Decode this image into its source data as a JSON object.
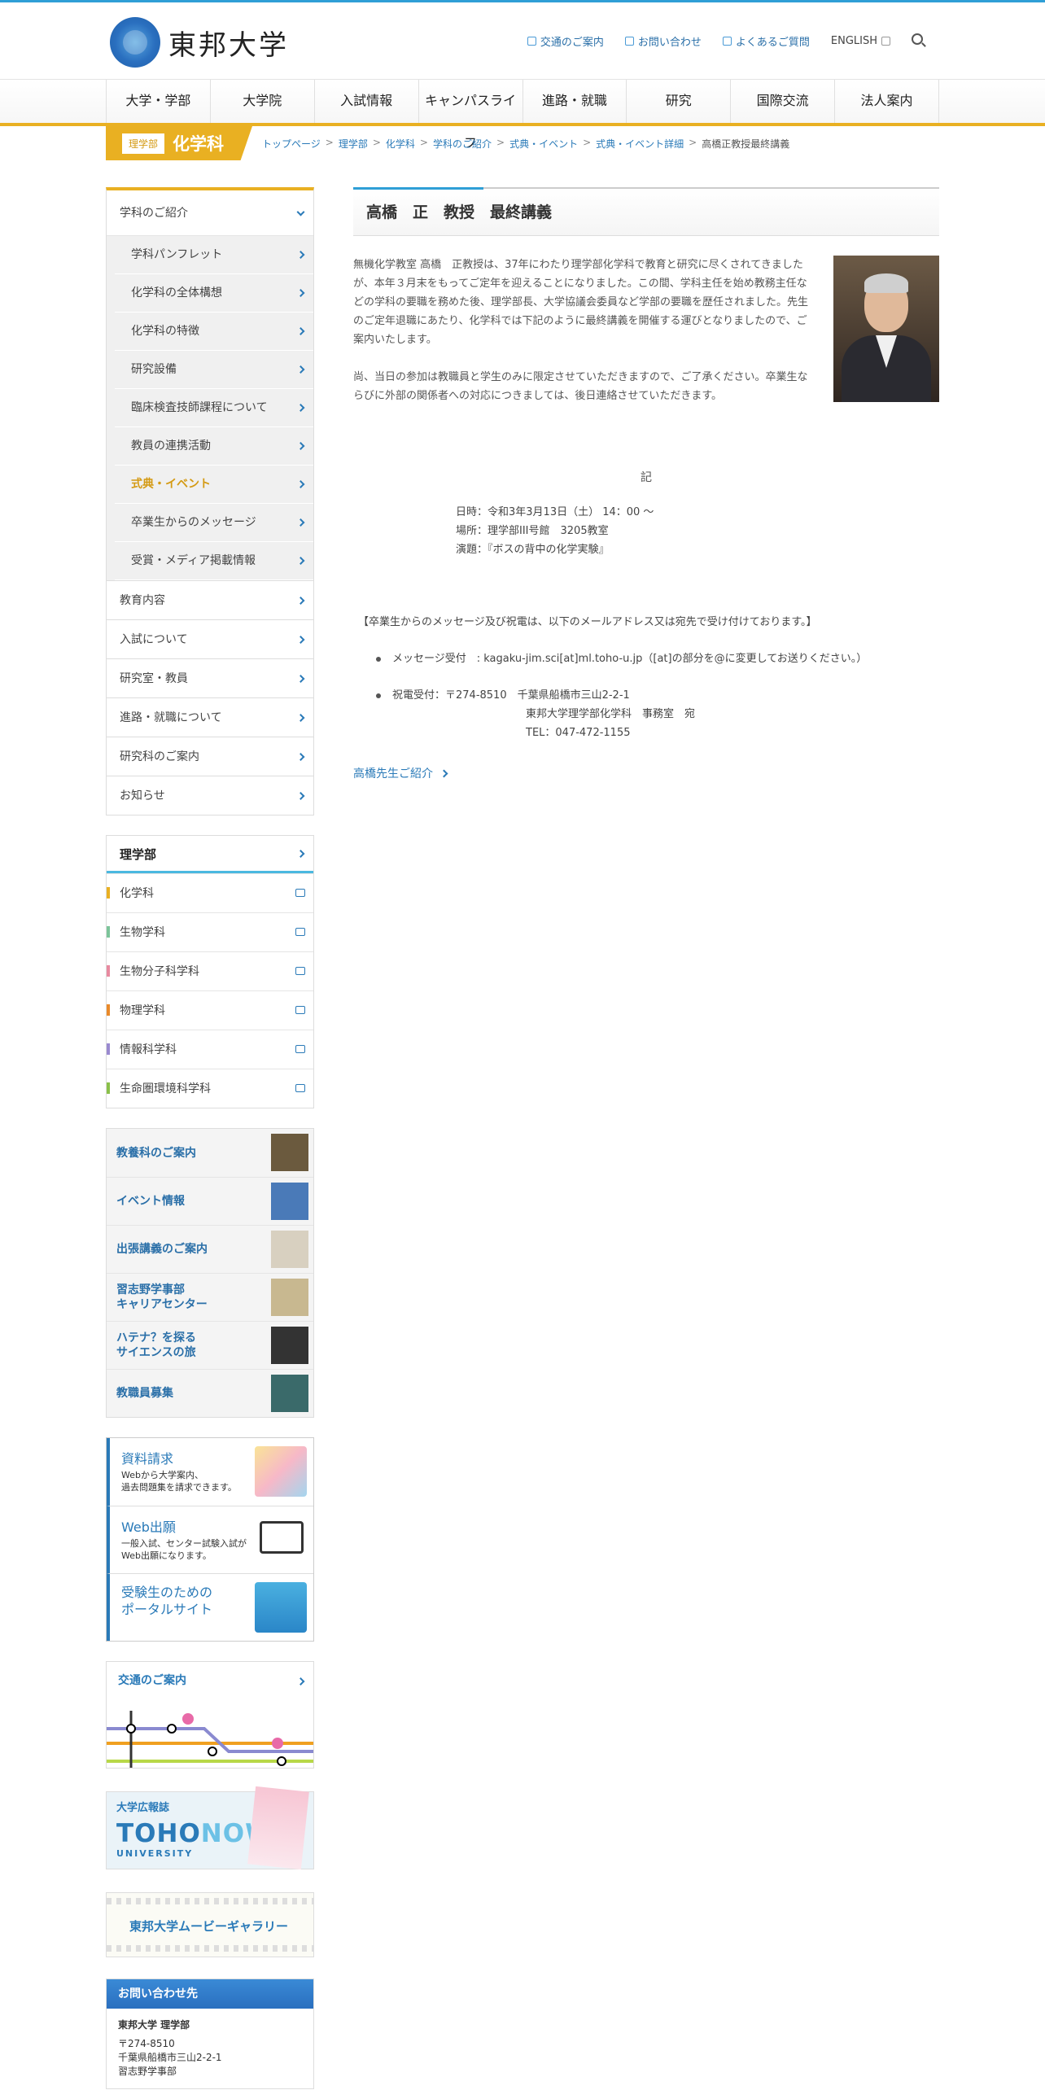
{
  "header": {
    "logo_text": "東邦大学",
    "util_links": [
      "交通のご案内",
      "お問い合わせ",
      "よくあるご質問"
    ],
    "english_label": "ENGLISH"
  },
  "gnav": [
    "大学・学部",
    "大学院",
    "入試情報",
    "キャンパスライフ",
    "進路・就職",
    "研究",
    "国際交流",
    "法人案内"
  ],
  "dept": {
    "tag": "理学部",
    "name": "化学科"
  },
  "breadcrumb": [
    "トップページ",
    "理学部",
    "化学科",
    "学科のご紹介",
    "式典・イベント",
    "式典・イベント詳細",
    "高橋正教授最終講義"
  ],
  "sidebar": {
    "menu_head": "学科のご紹介",
    "sub_items": [
      "学科パンフレット",
      "化学科の全体構想",
      "化学科の特徴",
      "研究設備",
      "臨床検査技師課程について",
      "教員の連携活動",
      "式典・イベント",
      "卒業生からのメッセージ",
      "受賞・メディア掲載情報"
    ],
    "active_index": 6,
    "menu_items": [
      "教育内容",
      "入試について",
      "研究室・教員",
      "進路・就職について",
      "研究科のご案内",
      "お知らせ"
    ],
    "rigaku_head": "理学部",
    "rigaku_items": [
      "化学科",
      "生物学科",
      "生物分子科学科",
      "物理学科",
      "情報科学科",
      "生命圏環境科学科"
    ],
    "rigaku_colors": [
      "#e9b022",
      "#7cc49a",
      "#e88aa0",
      "#e98a2a",
      "#9a8ad0",
      "#8ac04a"
    ],
    "links": [
      "教養科のご案内",
      "イベント情報",
      "出張講義のご案内",
      "習志野学事部\nキャリアセンター",
      "ハテナ？を探る\nサイエンスの旅",
      "教職員募集"
    ],
    "banners": [
      {
        "title": "資料請求",
        "sub": "Webから大学案内、\n過去問題集を請求できます。"
      },
      {
        "title": "Web出願",
        "sub": "一般入試、センター試験入試が\nWeb出願になります。"
      },
      {
        "title": "受験生のための\nポータルサイト",
        "sub": ""
      }
    ],
    "access_title": "交通のご案内",
    "magazine": {
      "small": "大学広報誌",
      "big_a": "TOHO",
      "big_b": "NOW",
      "uni": "UNIVERSITY"
    },
    "movie_text": "東邦大学ムービーギャラリー",
    "contact": {
      "head": "お問い合わせ先",
      "name": "東邦大学 理学部",
      "zip": "〒274-8510",
      "addr": "千葉県船橋市三山2-2-1",
      "dept": "習志野学事部"
    }
  },
  "main": {
    "title": "高橋　正　教授　最終講義",
    "intro_p1": "無機化学教室 高橋　正教授は、37年にわたり理学部化学科で教育と研究に尽くされてきましたが、本年３月末をもってご定年を迎えることになりました。この間、学科主任を始め教務主任などの学科の要職を務めた後、理学部長、大学協議会委員など学部の要職を歴任されました。先生のご定年退職にあたり、化学科では下記のように最終講義を開催する運びとなりましたので、ご案内いたします。",
    "intro_p2": "尚、当日の参加は教職員と学生のみに限定させていただきますので、ご了承ください。卒業生ならびに外部の関係者への対応につきましては、後日連絡させていただきます。",
    "ki": "記",
    "date": "日時：令和3年3月13日（土） 14：00 ～",
    "place": "場所：理学部III号館　3205教室",
    "topic": "演題：『ボスの背中の化学実験』",
    "msg": "【卒業生からのメッセージ及び祝電は、以下のメールアドレス又は宛先で受け付けております。】",
    "msg_line": "メッセージ受付　: kagaku-jim.sci[at]ml.toho-u.jp（[at]の部分を@に変更してお送りください。）",
    "tel_line1": "祝電受付：〒274-8510　千葉県船橋市三山2-2-1",
    "tel_line2": "東邦大学理学部化学科　事務室　宛",
    "tel_line3": "TEL：047-472-1155",
    "prof_link": "高橋先生ご紹介"
  }
}
